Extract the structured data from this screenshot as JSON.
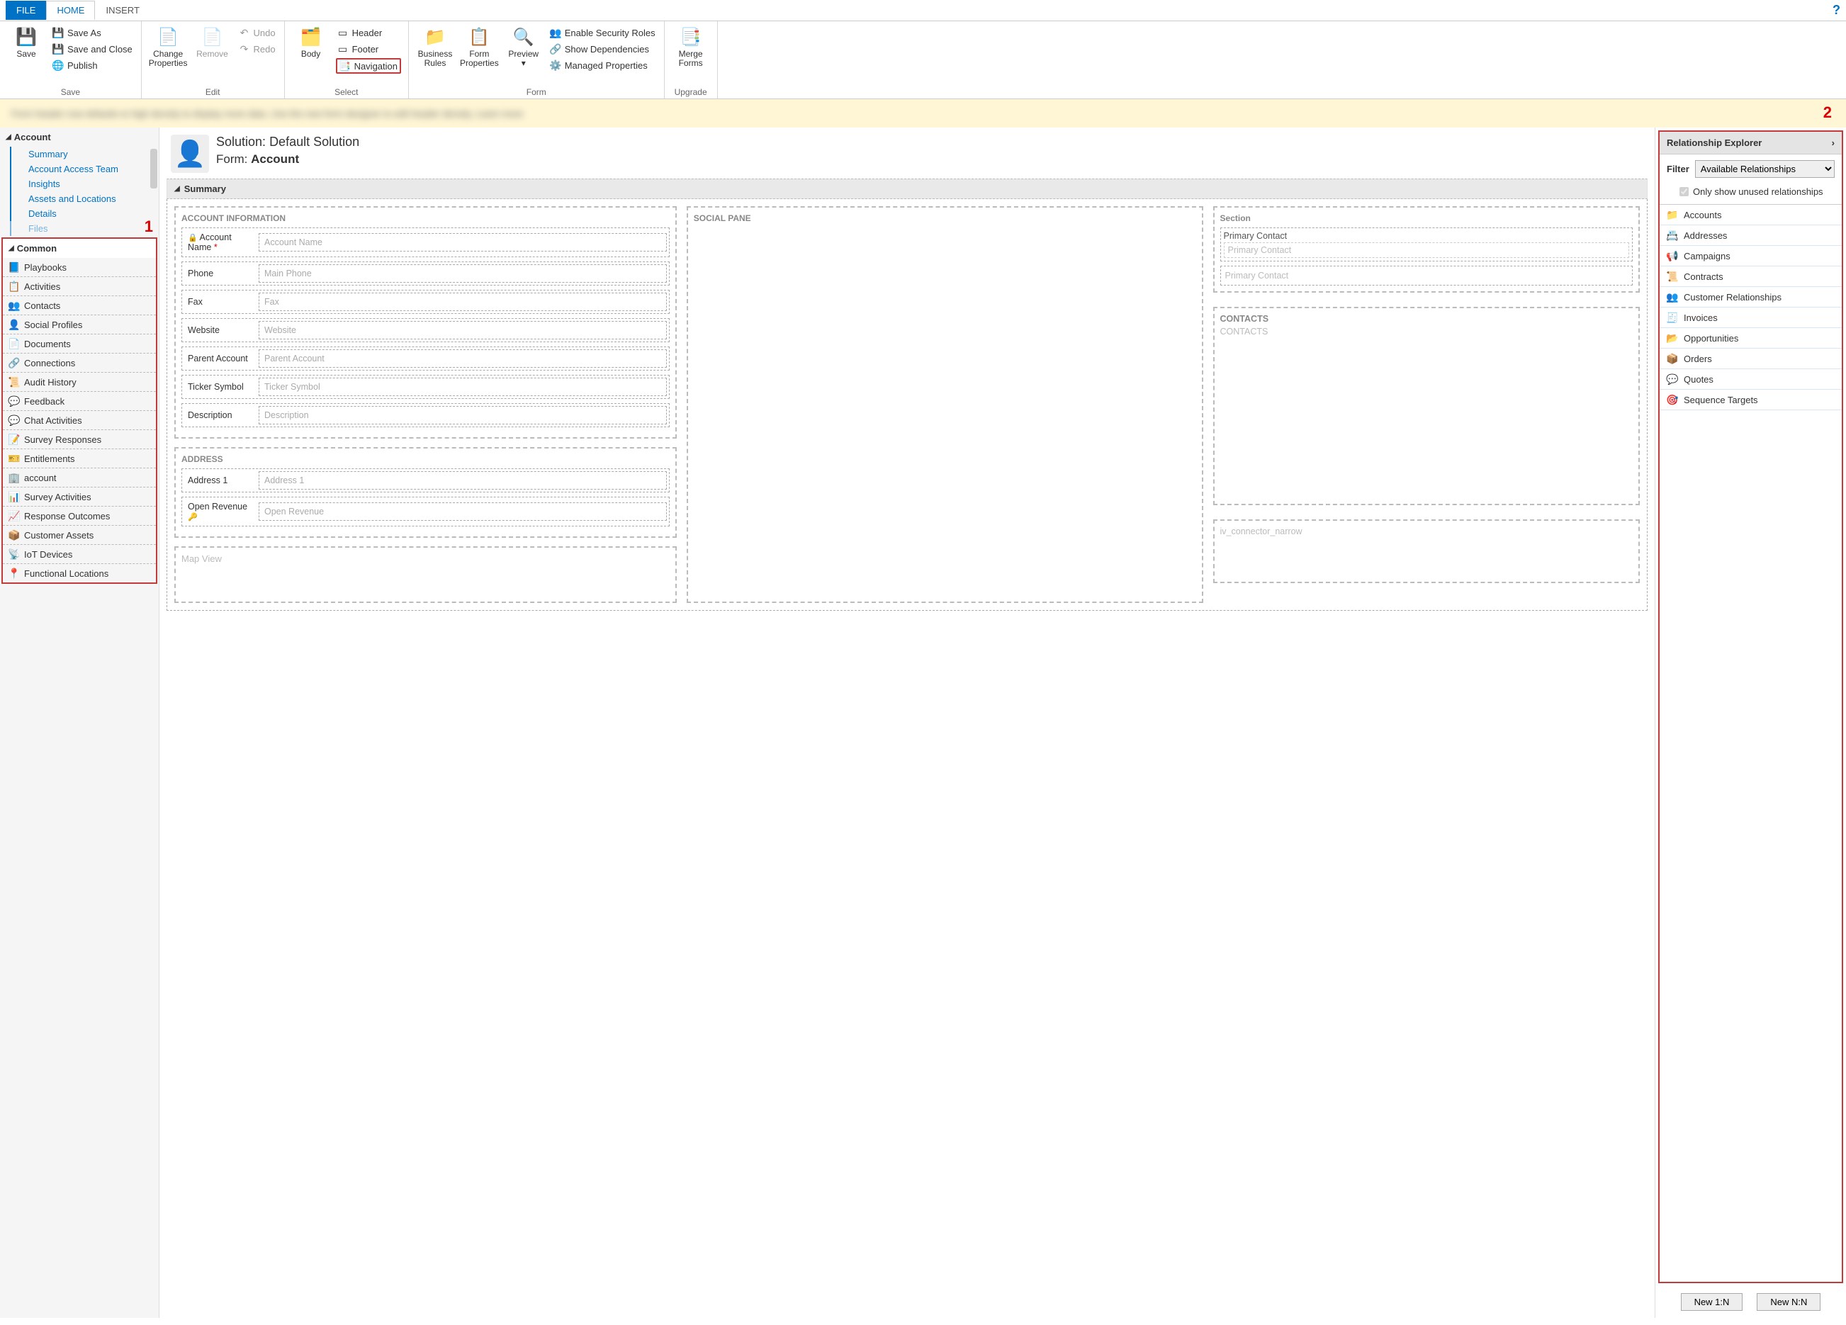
{
  "tabs": {
    "file": "FILE",
    "home": "HOME",
    "insert": "INSERT"
  },
  "ribbon": {
    "save": {
      "big": "Save",
      "save_as": "Save As",
      "save_close": "Save and Close",
      "publish": "Publish",
      "group": "Save"
    },
    "edit": {
      "change_props": "Change\nProperties",
      "remove": "Remove",
      "undo": "Undo",
      "redo": "Redo",
      "group": "Edit"
    },
    "select": {
      "body": "Body",
      "header": "Header",
      "footer": "Footer",
      "navigation": "Navigation",
      "group": "Select"
    },
    "form": {
      "biz_rules": "Business\nRules",
      "form_props": "Form\nProperties",
      "preview": "Preview",
      "sec_roles": "Enable Security Roles",
      "show_dep": "Show Dependencies",
      "managed": "Managed Properties",
      "group": "Form"
    },
    "upgrade": {
      "merge": "Merge\nForms",
      "group": "Upgrade"
    }
  },
  "markers": {
    "one": "1",
    "two": "2"
  },
  "left": {
    "account_hdr": "Account",
    "links": [
      "Summary",
      "Account Access Team",
      "Insights",
      "Assets and Locations",
      "Details",
      "Files"
    ],
    "common_hdr": "Common",
    "common": [
      "Playbooks",
      "Activities",
      "Contacts",
      "Social Profiles",
      "Documents",
      "Connections",
      "Audit History",
      "Feedback",
      "Chat Activities",
      "Survey Responses",
      "Entitlements",
      "account",
      "Survey Activities",
      "Response Outcomes",
      "Customer Assets",
      "IoT Devices",
      "Functional Locations"
    ]
  },
  "formhead": {
    "solution_lbl": "Solution: ",
    "solution_val": "Default Solution",
    "form_lbl": "Form: ",
    "form_val": "Account"
  },
  "summary": {
    "title": "Summary",
    "acct_info": "ACCOUNT INFORMATION",
    "social": "SOCIAL PANE",
    "section": "Section",
    "fields": {
      "account_name": {
        "l": "Account Name",
        "p": "Account Name"
      },
      "phone": {
        "l": "Phone",
        "p": "Main Phone"
      },
      "fax": {
        "l": "Fax",
        "p": "Fax"
      },
      "website": {
        "l": "Website",
        "p": "Website"
      },
      "parent": {
        "l": "Parent Account",
        "p": "Parent Account"
      },
      "ticker": {
        "l": "Ticker Symbol",
        "p": "Ticker Symbol"
      },
      "desc": {
        "l": "Description",
        "p": "Description"
      }
    },
    "address_hdr": "ADDRESS",
    "address1": {
      "l": "Address 1",
      "p": "Address 1"
    },
    "open_rev": {
      "l": "Open Revenue",
      "p": "Open Revenue"
    },
    "map_view": "Map View",
    "primary_contact": {
      "l": "Primary Contact",
      "p": "Primary Contact"
    },
    "primary_contact2": "Primary Contact",
    "contacts_hdr": "CONTACTS",
    "contacts_body": "CONTACTS",
    "iv_conn": "iv_connector_narrow"
  },
  "right": {
    "title": "Relationship Explorer",
    "filter_lbl": "Filter",
    "filter_val": "Available Relationships",
    "only_unused": "Only show unused relationships",
    "items": [
      "Accounts",
      "Addresses",
      "Campaigns",
      "Contracts",
      "Customer Relationships",
      "Invoices",
      "Opportunities",
      "Orders",
      "Quotes",
      "Sequence Targets"
    ],
    "new_1n": "New 1:N",
    "new_nn": "New N:N"
  }
}
